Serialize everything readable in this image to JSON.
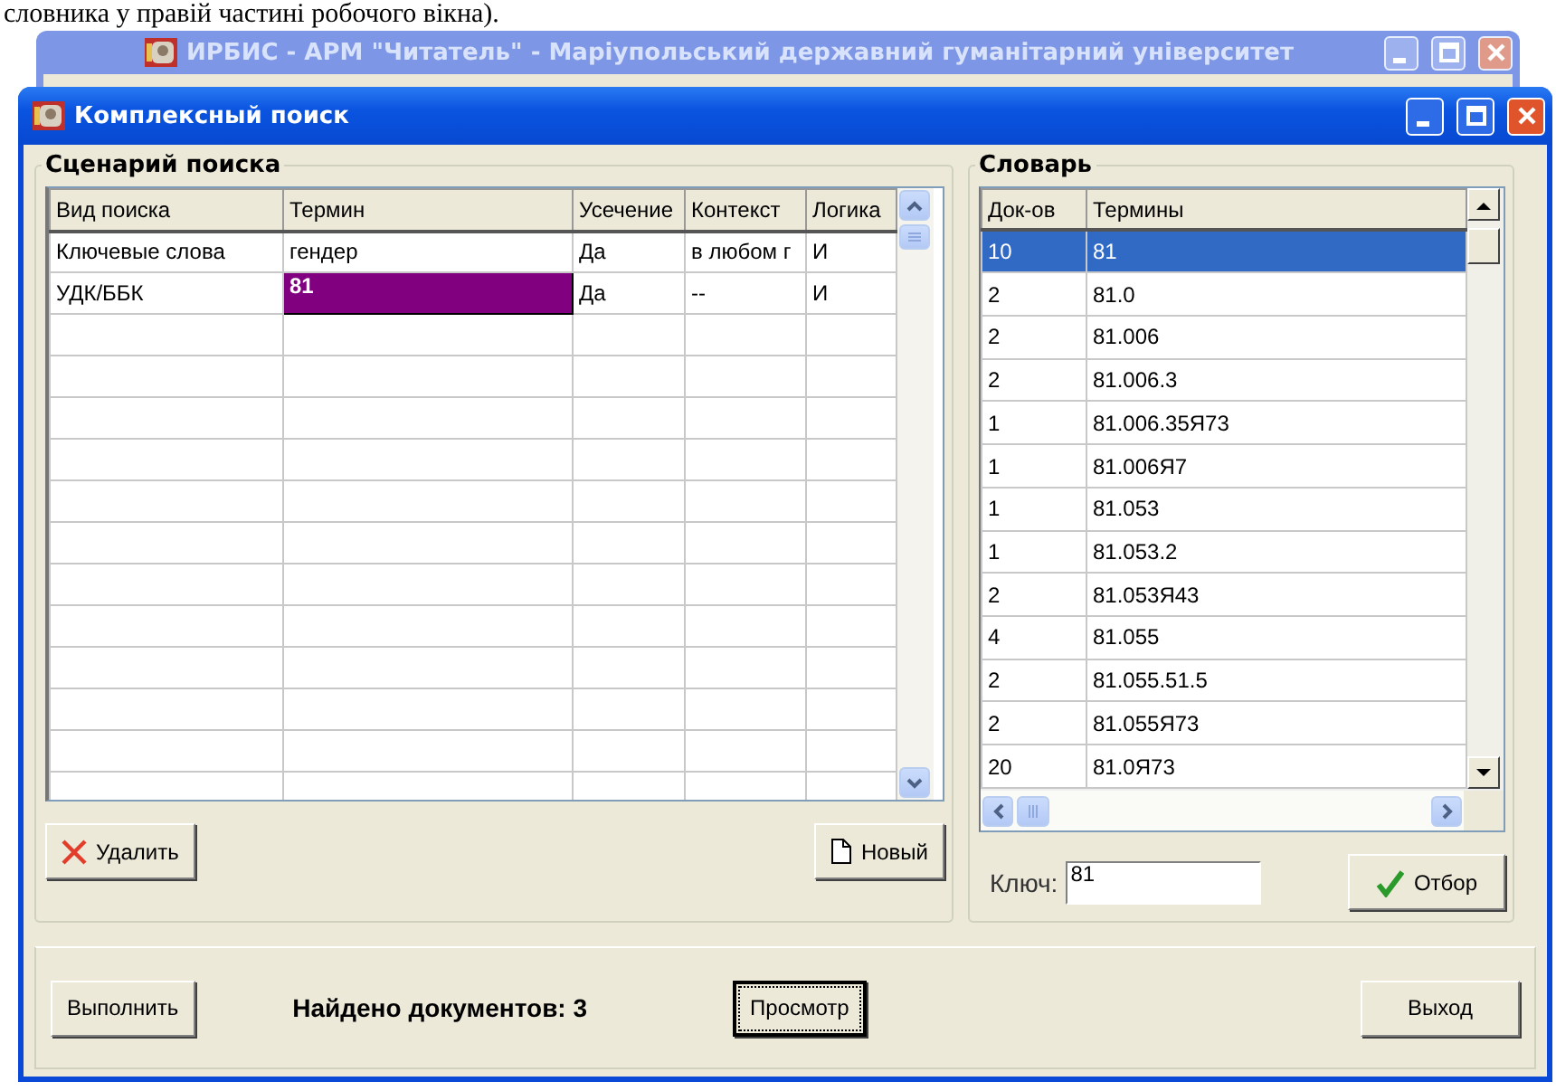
{
  "document_text": "словника у правій частині робочого вікна).",
  "back_window": {
    "title": "ИРБИС - АРМ \"Читатель\" - Маріупольський державний гуманітарний університет"
  },
  "dialog": {
    "title": "Комплексный поиск"
  },
  "scenario": {
    "title": "Сценарий поиска",
    "columns": [
      "Вид поиска",
      "Термин",
      "Усечение",
      "Контекст",
      "Логика"
    ],
    "rows": [
      {
        "cells": [
          "Ключевые слова",
          "гендер",
          "Да",
          "в любом г",
          "И"
        ],
        "selected": false
      },
      {
        "cells": [
          "УДК/ББК",
          "81",
          "Да",
          "--",
          "И"
        ],
        "selected": true
      }
    ],
    "delete_button": "Удалить",
    "new_button": "Новый"
  },
  "dictionary": {
    "title": "Словарь",
    "columns": [
      "Док-ов",
      "Термины"
    ],
    "rows": [
      {
        "count": "10",
        "term": "81",
        "selected": true
      },
      {
        "count": "2",
        "term": "81.0",
        "selected": false
      },
      {
        "count": "2",
        "term": "81.006",
        "selected": false
      },
      {
        "count": "2",
        "term": "81.006.3",
        "selected": false
      },
      {
        "count": "1",
        "term": "81.006.35Я73",
        "selected": false
      },
      {
        "count": "1",
        "term": "81.006Я7",
        "selected": false
      },
      {
        "count": "1",
        "term": "81.053",
        "selected": false
      },
      {
        "count": "1",
        "term": "81.053.2",
        "selected": false
      },
      {
        "count": "2",
        "term": "81.053Я43",
        "selected": false
      },
      {
        "count": "4",
        "term": "81.055",
        "selected": false
      },
      {
        "count": "2",
        "term": "81.055.51.5",
        "selected": false
      },
      {
        "count": "2",
        "term": "81.055Я73",
        "selected": false
      },
      {
        "count": "20",
        "term": "81.0Я73",
        "selected": false
      }
    ],
    "key_label": "Ключ:",
    "key_value": "81",
    "filter_button": "Отбор"
  },
  "footer": {
    "run_button": "Выполнить",
    "found_text": "Найдено документов: 3",
    "view_button": "Просмотр",
    "exit_button": "Выход"
  }
}
